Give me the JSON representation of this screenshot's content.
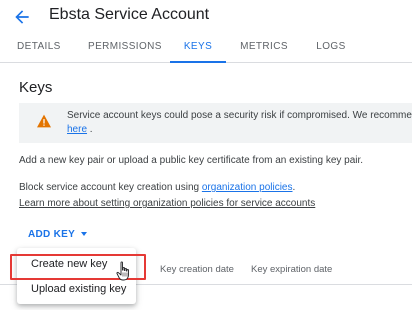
{
  "header": {
    "title": "Ebsta Service Account"
  },
  "tabs": [
    {
      "label": "DETAILS",
      "active": false
    },
    {
      "label": "PERMISSIONS",
      "active": false
    },
    {
      "label": "KEYS",
      "active": true
    },
    {
      "label": "METRICS",
      "active": false
    },
    {
      "label": "LOGS",
      "active": false
    }
  ],
  "keys": {
    "section_title": "Keys",
    "warning_text": "Service account keys could pose a security risk if compromised. We recommend y",
    "warning_link": "here",
    "warning_link_suffix": ".",
    "intro_text": "Add a new key pair or upload a public key certificate from an existing key pair.",
    "block_text": "Block service account key creation using ",
    "block_link": "organization policies",
    "block_suffix": ".",
    "learn_more_link": "Learn more about setting organization policies for service accounts",
    "add_key_label": "ADD KEY",
    "columns": [
      "Key creation date",
      "Key expiration date"
    ]
  },
  "dropdown": {
    "items": [
      "Create new key",
      "Upload existing key"
    ]
  },
  "colors": {
    "accent": "#1a73e8",
    "warning": "#e37400",
    "highlight": "#e53935"
  },
  "icons": {
    "back": "arrow-back-icon",
    "warning": "warning-icon",
    "caret": "caret-down-icon",
    "cursor": "hand-pointer-icon"
  }
}
